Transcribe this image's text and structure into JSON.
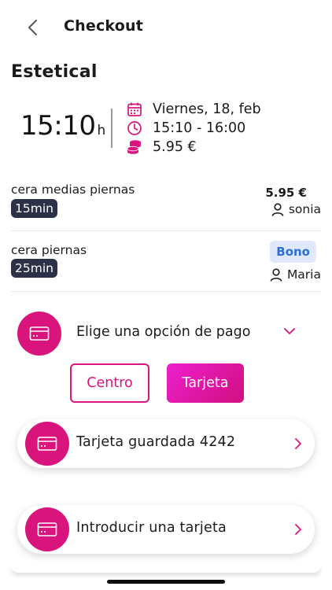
{
  "header": {
    "title": "Checkout",
    "back_icon": "chevron-left-icon"
  },
  "salon": {
    "name": "Estetical"
  },
  "booking": {
    "time": "15:10",
    "time_suffix": "h",
    "date": "Viernes, 18, feb",
    "time_range": "15:10 - 16:00",
    "price": "5.95 €"
  },
  "services": [
    {
      "name": "cera medias piernas",
      "duration": "15min",
      "price": "5.95 €",
      "staff": "sonia"
    },
    {
      "name": "cera piernas",
      "duration": "25min",
      "badge": "Bono",
      "staff": "Maria"
    }
  ],
  "payment": {
    "choose_label": "Elige una opción de pago",
    "options": [
      "Centro",
      "Tarjeta"
    ],
    "selected": "Tarjeta",
    "saved_card": "Tarjeta guardada 4242",
    "new_card": "Introducir una tarjeta"
  },
  "colors": {
    "accent": "#d9147d",
    "accent_gradient_start": "#ee1fce",
    "badge_dark": "#2c3148",
    "bono_bg": "#dfe9fb",
    "bono_text": "#2d6fd6"
  }
}
